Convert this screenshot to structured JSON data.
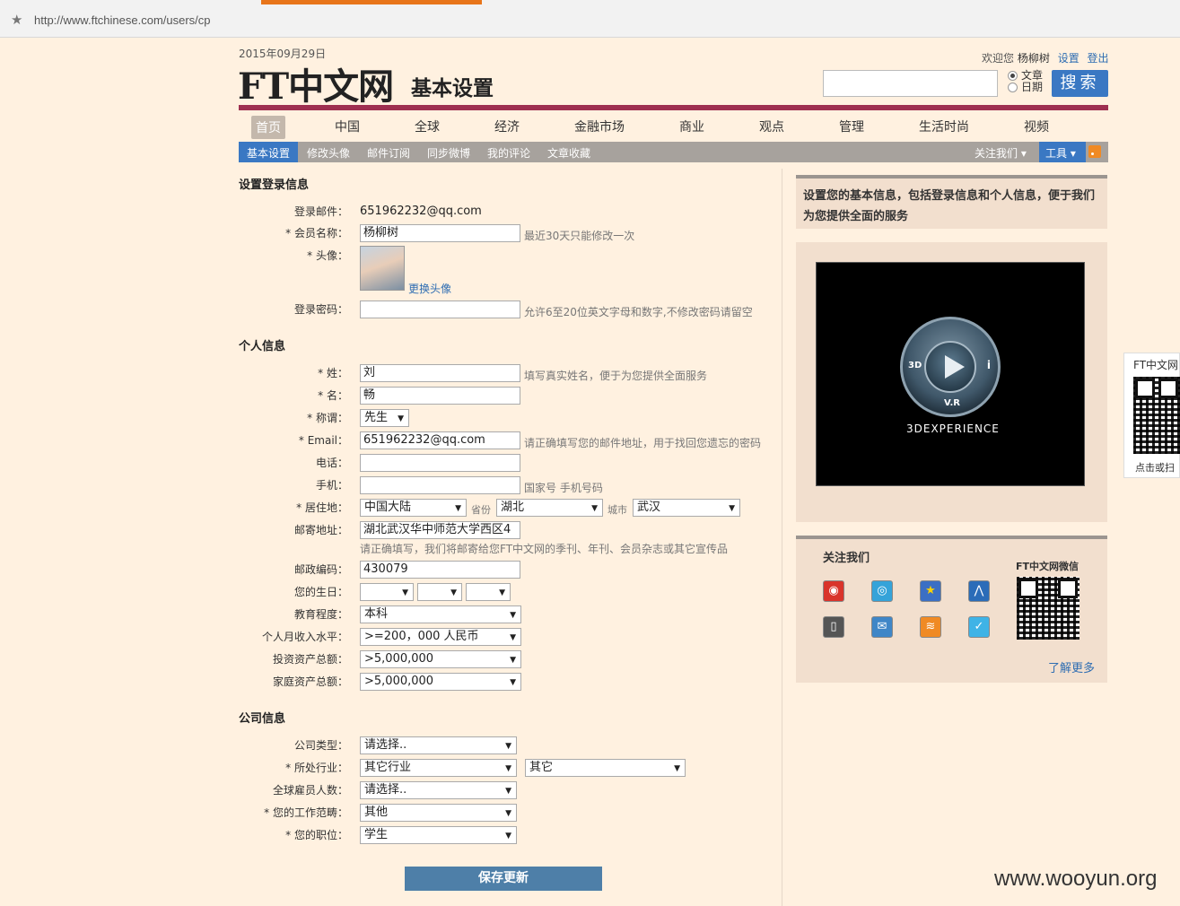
{
  "browser": {
    "url": "http://www.ftchinese.com/users/cp"
  },
  "header": {
    "date": "2015年09月29日",
    "logo": "FT中文网",
    "page_title": "基本设置",
    "welcome": "欢迎您",
    "username": "杨柳树",
    "settings_link": "设置",
    "logout_link": "登出",
    "radio_article": "文章",
    "radio_date": "日期",
    "search_button": "搜索"
  },
  "nav": {
    "items": [
      "首页",
      "中国",
      "全球",
      "经济",
      "金融市场",
      "商业",
      "观点",
      "管理",
      "生活时尚",
      "视频"
    ]
  },
  "subnav": {
    "items": [
      "基本设置",
      "修改头像",
      "邮件订阅",
      "同步微博",
      "我的评论",
      "文章收藏"
    ],
    "follow_us": "关注我们 ▾",
    "tools": "工具 ▾"
  },
  "login_section": {
    "title": "设置登录信息",
    "email_label": "登录邮件：",
    "email_value": "651962232@qq.com",
    "nickname_label": "* 会员名称：",
    "nickname_value": "杨柳树",
    "nickname_hint": "最近30天只能修改一次",
    "avatar_label": "* 头像：",
    "avatar_link": "更换头像",
    "password_label": "登录密码：",
    "password_hint": "允许6至20位英文字母和数字,不修改密码请留空"
  },
  "personal_section": {
    "title": "个人信息",
    "surname_label": "* 姓：",
    "surname_value": "刘",
    "surname_hint": "填写真实姓名，便于为您提供全面服务",
    "given_label": "* 名：",
    "given_value": "畅",
    "title_label": "* 称谓：",
    "title_value": "先生",
    "email_label": "* Email：",
    "email_value": "651962232@qq.com",
    "email_hint": "请正确填写您的邮件地址，用于找回您遗忘的密码",
    "phone_label": "电话：",
    "mobile_label": "手机：",
    "mobile_hint": "国家号 手机号码",
    "residence_label": "* 居住地：",
    "country_value": "中国大陆",
    "province_label": "省份",
    "province_value": "湖北",
    "city_label": "城市",
    "city_value": "武汉",
    "address_label": "邮寄地址：",
    "address_value": "湖北武汉华中师范大学西区4",
    "address_hint": "请正确填写，我们将邮寄给您FT中文网的季刊、年刊、会员杂志或其它宣传品",
    "zip_label": "邮政编码：",
    "zip_value": "430079",
    "birthday_label": "您的生日：",
    "education_label": "教育程度：",
    "education_value": "本科",
    "income_label": "个人月收入水平：",
    "income_value": ">=200，000 人民币",
    "invest_label": "投资资产总额：",
    "invest_value": ">5,000,000",
    "family_label": "家庭资产总额：",
    "family_value": ">5,000,000"
  },
  "company_section": {
    "title": "公司信息",
    "type_label": "公司类型：",
    "type_value": "请选择..",
    "industry_label": "* 所处行业：",
    "industry_value": "其它行业",
    "industry_sub_value": "其它",
    "employees_label": "全球雇员人数：",
    "employees_value": "请选择..",
    "scope_label": "* 您的工作范畴：",
    "scope_value": "其他",
    "position_label": "* 您的职位：",
    "position_value": "学生"
  },
  "save_button": "保存更新",
  "sidebar": {
    "intro": "设置您的基本信息，包括登录信息和个人信息，便于我们为您提供全面的服务",
    "ad_3d": "3D",
    "ad_i": "i",
    "ad_vr": "V.R",
    "ad_brand": "3DEXPERIENCE",
    "follow_title": "关注我们",
    "wechat_title": "FT中文网微信",
    "learn_more": "了解更多",
    "float_title": "FT中文网",
    "float_bottom": "点击或扫"
  },
  "watermark": "www.wooyun.org",
  "colors": {
    "accent": "#3a78c3",
    "brand_bar": "#9e2f50",
    "page_bg": "#fff1e0"
  }
}
